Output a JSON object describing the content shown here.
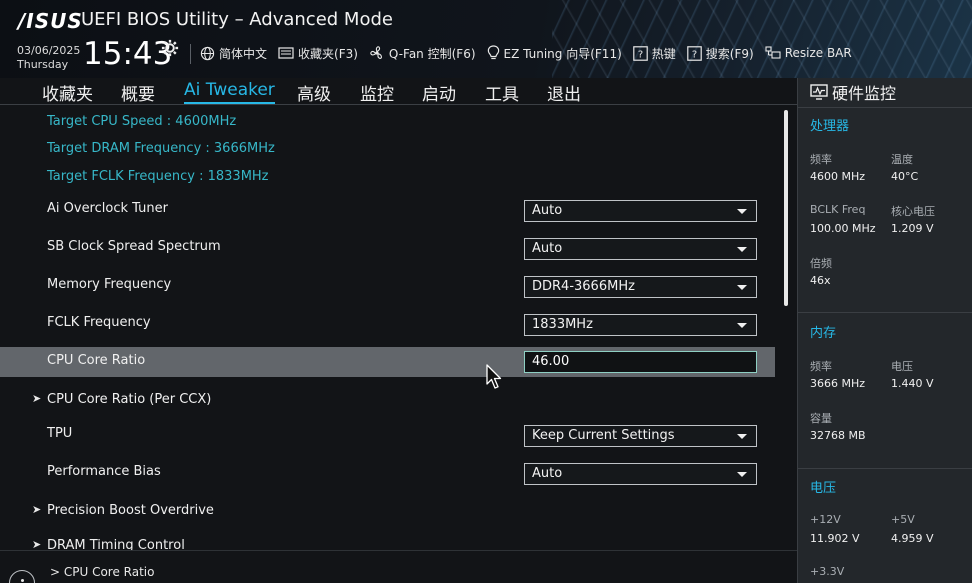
{
  "header": {
    "logo": "/ISUS",
    "title": "UEFI BIOS Utility – Advanced Mode",
    "date": "03/06/2025",
    "weekday": "Thursday",
    "time": "15:43",
    "toolbar": [
      {
        "label": "简体中文",
        "icon": "globe-icon"
      },
      {
        "label": "收藏夹(F3)",
        "icon": "folder-icon"
      },
      {
        "label": "Q-Fan 控制(F6)",
        "icon": "fan-icon"
      },
      {
        "label": "EZ Tuning 向导(F11)",
        "icon": "bulb-icon"
      },
      {
        "label": "热键",
        "icon": "question-icon"
      },
      {
        "label": "搜索(F9)",
        "icon": "question-icon"
      },
      {
        "label": "Resize BAR",
        "icon": "resize-bar-icon"
      }
    ]
  },
  "tabs": [
    {
      "label": "收藏夹"
    },
    {
      "label": "概要"
    },
    {
      "label": "Ai Tweaker",
      "active": true
    },
    {
      "label": "高级"
    },
    {
      "label": "监控"
    },
    {
      "label": "启动"
    },
    {
      "label": "工具"
    },
    {
      "label": "退出"
    }
  ],
  "info": [
    "Target CPU Speed : 4600MHz",
    "Target DRAM Frequency : 3666MHz",
    "Target FCLK Frequency : 1833MHz"
  ],
  "settings": [
    {
      "label": "Ai Overclock Tuner",
      "type": "select",
      "value": "Auto"
    },
    {
      "label": "SB Clock Spread Spectrum",
      "type": "select",
      "value": "Auto"
    },
    {
      "label": "Memory Frequency",
      "type": "select",
      "value": "DDR4-3666MHz"
    },
    {
      "label": "FCLK Frequency",
      "type": "select",
      "value": "1833MHz"
    },
    {
      "label": "CPU Core Ratio",
      "type": "text",
      "value": "46.00",
      "selected": true
    },
    {
      "label": "CPU Core Ratio (Per CCX)",
      "type": "submenu"
    },
    {
      "label": "TPU",
      "type": "select",
      "value": "Keep Current Settings"
    },
    {
      "label": "Performance Bias",
      "type": "select",
      "value": "Auto"
    },
    {
      "label": "Precision Boost Overdrive",
      "type": "submenu"
    },
    {
      "label": "DRAM Timing Control",
      "type": "submenu"
    }
  ],
  "help": {
    "text": "> CPU Core Ratio"
  },
  "monitor": {
    "title": "硬件监控",
    "cpu": {
      "title": "处理器",
      "freq_label": "频率",
      "freq_value": "4600 MHz",
      "temp_label": "温度",
      "temp_value": "40°C",
      "bclk_label": "BCLK Freq",
      "bclk_value": "100.00 MHz",
      "vcore_label": "核心电压",
      "vcore_value": "1.209 V",
      "ratio_label": "倍频",
      "ratio_value": "46x"
    },
    "memory": {
      "title": "内存",
      "freq_label": "频率",
      "freq_value": "3666 MHz",
      "volt_label": "电压",
      "volt_value": "1.440 V",
      "cap_label": "容量",
      "cap_value": "32768 MB"
    },
    "voltage": {
      "title": "电压",
      "v12_label": "+12V",
      "v12_value": "11.902 V",
      "v5_label": "+5V",
      "v5_value": "4.959 V",
      "v33_label": "+3.3V"
    }
  },
  "colors": {
    "accent": "#27b8e6",
    "info_text": "#37b7c8",
    "selected_row": "#62666b",
    "background": "#121417",
    "monitor_bg": "#23272b"
  }
}
